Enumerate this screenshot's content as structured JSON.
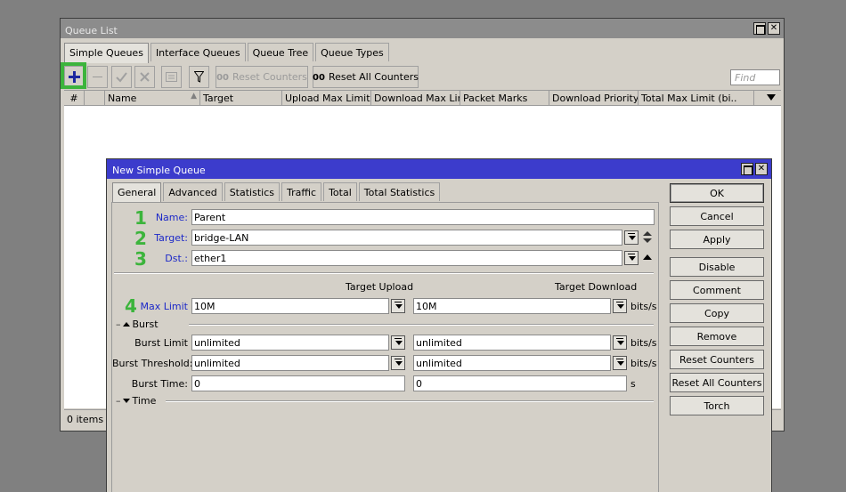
{
  "queue_list": {
    "title": "Queue List",
    "tabs": [
      "Simple Queues",
      "Interface Queues",
      "Queue Tree",
      "Queue Types"
    ],
    "toolbar": {
      "add_icon": "plus-icon",
      "remove_icon": "minus-icon",
      "enable_icon": "check-icon",
      "disable_icon": "x-icon",
      "comment_icon": "note-icon",
      "filter_icon": "filter-icon",
      "reset_counters_prefix": "00",
      "reset_counters": "Reset Counters",
      "reset_all_prefix": "00",
      "reset_all": "Reset All Counters",
      "find_placeholder": "Find"
    },
    "columns": [
      "#",
      "",
      "Name",
      "Target",
      "Upload Max Limit",
      "Download Max Limit",
      "Packet Marks",
      "Download Priority",
      "Total Max Limit (bi.."
    ],
    "status": "0 items"
  },
  "new_queue": {
    "title": "New Simple Queue",
    "tabs": [
      "General",
      "Advanced",
      "Statistics",
      "Traffic",
      "Total",
      "Total Statistics"
    ],
    "fields": {
      "name_label": "Name:",
      "name_value": "Parent",
      "target_label": "Target:",
      "target_value": "bridge-LAN",
      "dst_label": "Dst.:",
      "dst_value": "ether1",
      "target_upload_header": "Target Upload",
      "target_download_header": "Target Download",
      "max_limit_label": "Max Limit",
      "max_limit_upload": "10M",
      "max_limit_download": "10M",
      "burst_section": "Burst",
      "burst_limit_label": "Burst Limit",
      "burst_limit_upload": "unlimited",
      "burst_limit_download": "unlimited",
      "burst_threshold_label": "Burst Threshold:",
      "burst_threshold_upload": "unlimited",
      "burst_threshold_download": "unlimited",
      "burst_time_label": "Burst Time:",
      "burst_time_upload": "0",
      "burst_time_download": "0",
      "time_section": "Time",
      "unit_bits": "bits/s",
      "unit_s": "s"
    },
    "buttons": [
      "OK",
      "Cancel",
      "Apply",
      "Disable",
      "Comment",
      "Copy",
      "Remove",
      "Reset Counters",
      "Reset All Counters",
      "Torch"
    ]
  },
  "annotations": [
    "1",
    "2",
    "3",
    "4"
  ],
  "colors": {
    "annotation_green": "#3cb43c",
    "titlebar_blue": "#3c3ccc",
    "label_blue": "#1c28c8"
  }
}
